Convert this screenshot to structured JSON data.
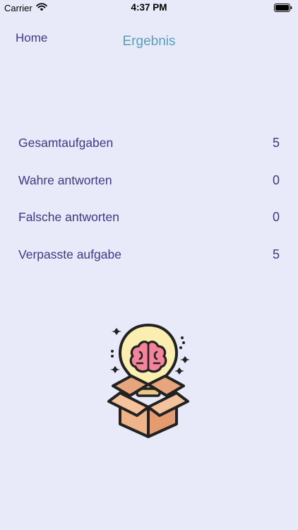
{
  "status_bar": {
    "carrier": "Carrier",
    "time": "4:37 PM"
  },
  "nav": {
    "back_label": "Home",
    "title": "Ergebnis"
  },
  "stats": [
    {
      "label": "Gesamtaufgaben",
      "value": "5"
    },
    {
      "label": "Wahre antworten",
      "value": "0"
    },
    {
      "label": "Falsche antworten",
      "value": "0"
    },
    {
      "label": "Verpasste aufgabe",
      "value": "5"
    }
  ],
  "illustration": {
    "icon": "brain-lightbulb-box-icon"
  },
  "colors": {
    "background": "#e9eaf9",
    "text": "#3d3a82",
    "title": "#5a9eb8"
  }
}
